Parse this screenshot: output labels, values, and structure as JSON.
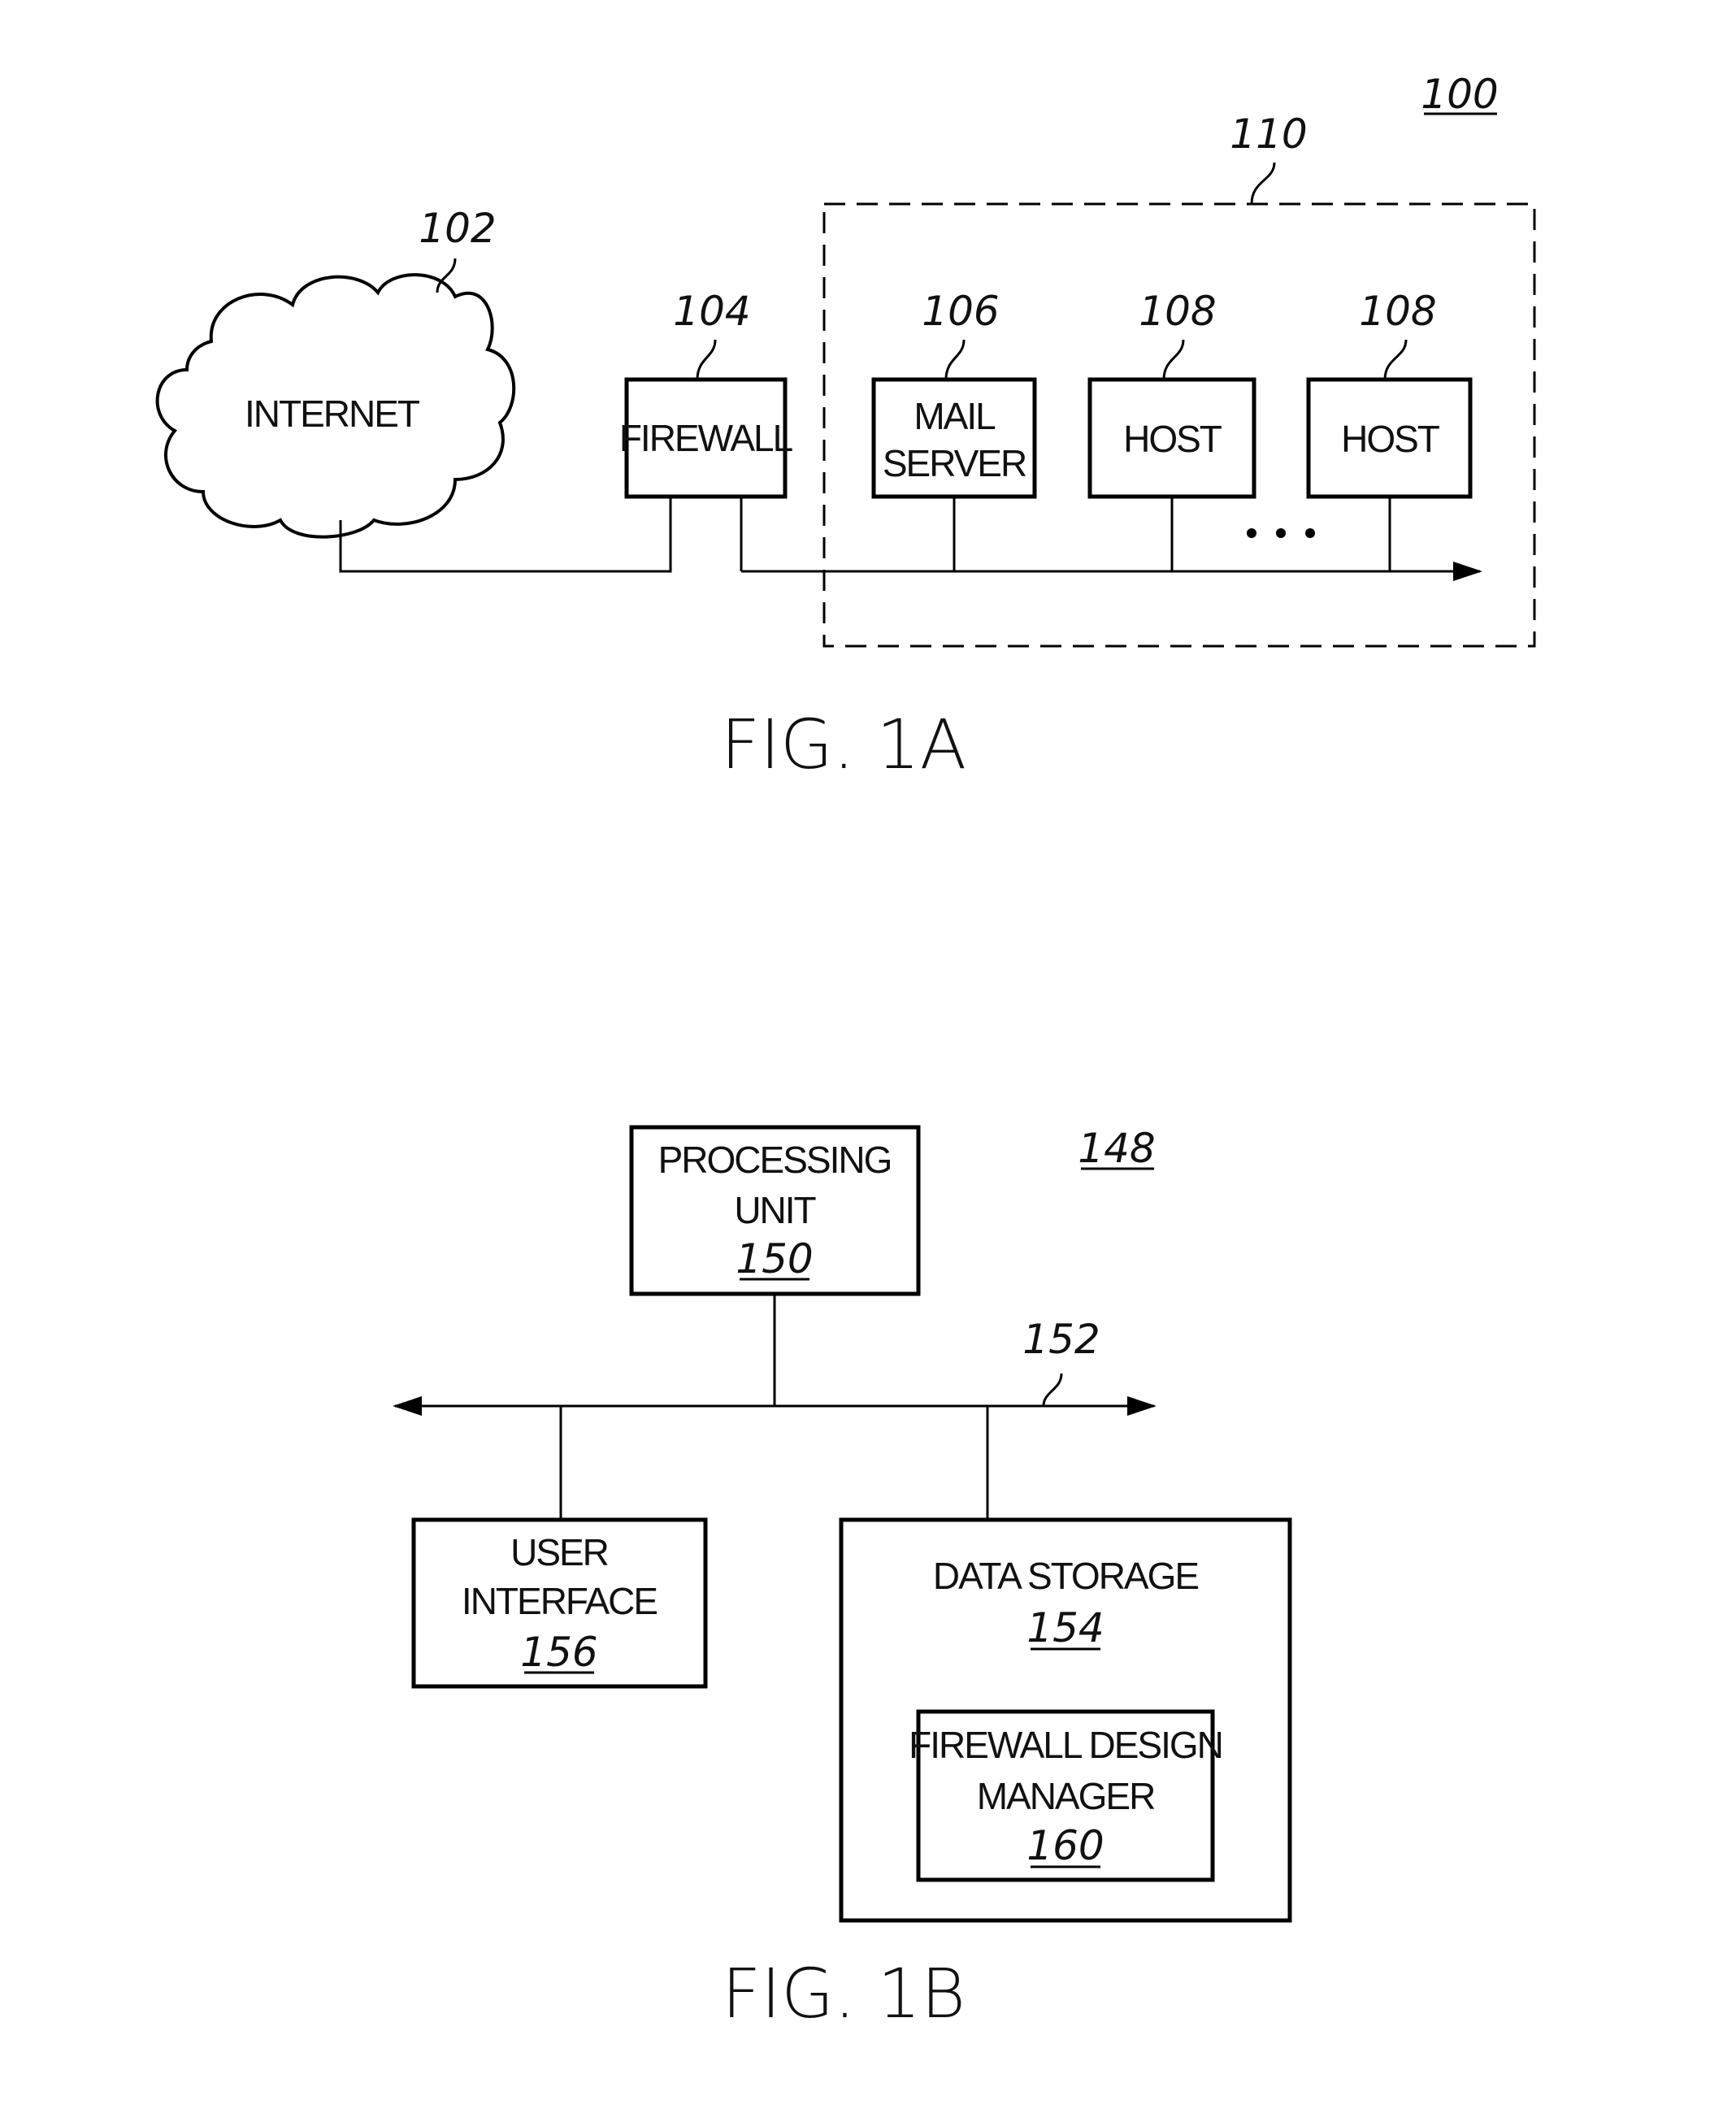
{
  "fig1a": {
    "caption": "FIG. 1A",
    "system_ref": "100",
    "network_group_ref": "110",
    "internet": {
      "label": "INTERNET",
      "ref": "102"
    },
    "firewall": {
      "label": "FIREWALL",
      "ref": "104"
    },
    "mail_server": {
      "label_line1": "MAIL",
      "label_line2": "SERVER",
      "ref": "106"
    },
    "hosts": [
      {
        "label": "HOST",
        "ref": "108"
      },
      {
        "label": "HOST",
        "ref": "108"
      }
    ],
    "ellipsis": "• • •"
  },
  "fig1b": {
    "caption": "FIG. 1B",
    "system_ref": "148",
    "bus_ref": "152",
    "processing_unit": {
      "label_line1": "PROCESSING",
      "label_line2": "UNIT",
      "ref": "150"
    },
    "user_interface": {
      "label_line1": "USER",
      "label_line2": "INTERFACE",
      "ref": "156"
    },
    "data_storage": {
      "label": "DATA STORAGE",
      "ref": "154"
    },
    "firewall_design_manager": {
      "label_line1": "FIREWALL DESIGN",
      "label_line2": "MANAGER",
      "ref": "160"
    }
  }
}
